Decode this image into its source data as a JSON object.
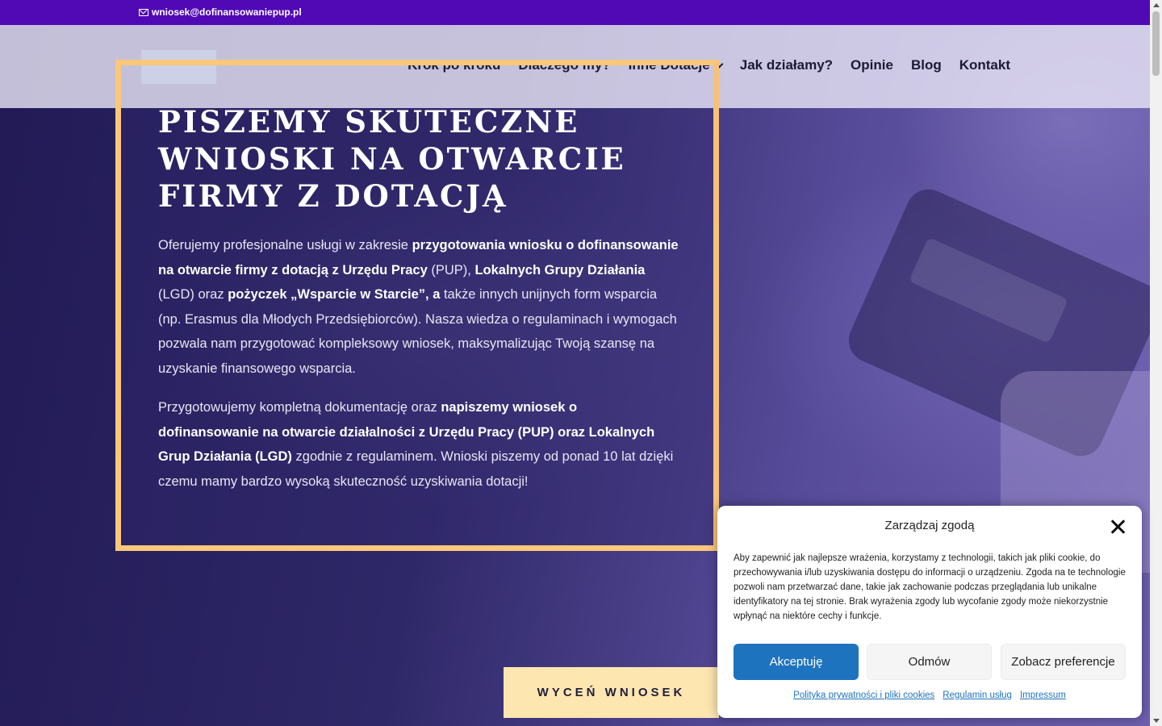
{
  "topbar": {
    "email": "wniosek@dofinansowaniepup.pl",
    "email_icon": "mail-icon"
  },
  "nav": {
    "items": [
      {
        "label": "Krok po kroku"
      },
      {
        "label": "Dlaczego my?"
      },
      {
        "label": "Inne Dotacje",
        "has_dropdown": true
      },
      {
        "label": "Jak działamy?"
      },
      {
        "label": "Opinie"
      },
      {
        "label": "Blog"
      },
      {
        "label": "Kontakt"
      }
    ]
  },
  "hero": {
    "headline": "PISZEMY SKUTECZNE WNIOSKI NA OTWARCIE FIRMY Z DOTACJĄ",
    "p1": {
      "t1": " Oferujemy profesjonalne usługi w zakresie ",
      "b1": "przygotowania wniosku o dofinansowanie na otwarcie firmy z dotacją z Urzędu Pracy",
      "t2": " (PUP), ",
      "b2": "Lokalnych Grupy Działania",
      "t3": " (LGD) oraz ",
      "b3": "pożyczek „Wsparcie w Starcie”,  a",
      "t4": " także innych unijnych form wsparcia (np. Erasmus dla Młodych Przedsiębiorców). Nasza wiedza o regulaminach i wymogach pozwala nam przygotować kompleksowy wniosek, maksymalizując Twoją szansę na uzyskanie finansowego wsparcia."
    },
    "p2": {
      "t1": "Przygotowujemy kompletną dokumentację oraz ",
      "b1": "napiszemy wniosek o dofinansowanie na otwarcie działalności z Urzędu Pracy (PUP) oraz Lokalnych Grup Działania (LGD)",
      "t2": " zgodnie z regulaminem. Wnioski piszemy od ponad 10 lat dzięki czemu mamy bardzo wysoką skuteczność uzyskiwania dotacji!"
    },
    "cta": "WYCEŃ WNIOSEK",
    "frame_color": "#fbc77a"
  },
  "consent": {
    "title": "Zarządzaj zgodą",
    "message": "Aby zapewnić jak najlepsze wrażenia, korzystamy z technologii, takich jak pliki cookie, do przechowywania i/lub uzyskiwania dostępu do informacji o urządzeniu. Zgoda na te technologie pozwoli nam przetwarzać dane, takie jak zachowanie podczas przeglądania lub unikalne identyfikatory na tej stronie. Brak wyrażenia zgody lub wycofanie zgody może niekorzystnie wpłynąć na niektóre cechy i funkcje.",
    "accept": "Akceptuję",
    "deny": "Odmów",
    "preferences": "Zobacz preferencje",
    "links": [
      "Polityka prywatności i pliki cookies",
      "Regulamin usług",
      "Impressum"
    ],
    "accent": "#1e73be"
  },
  "colors": {
    "topbar": "#5109b6",
    "cta_bg": "#fde6b0"
  }
}
